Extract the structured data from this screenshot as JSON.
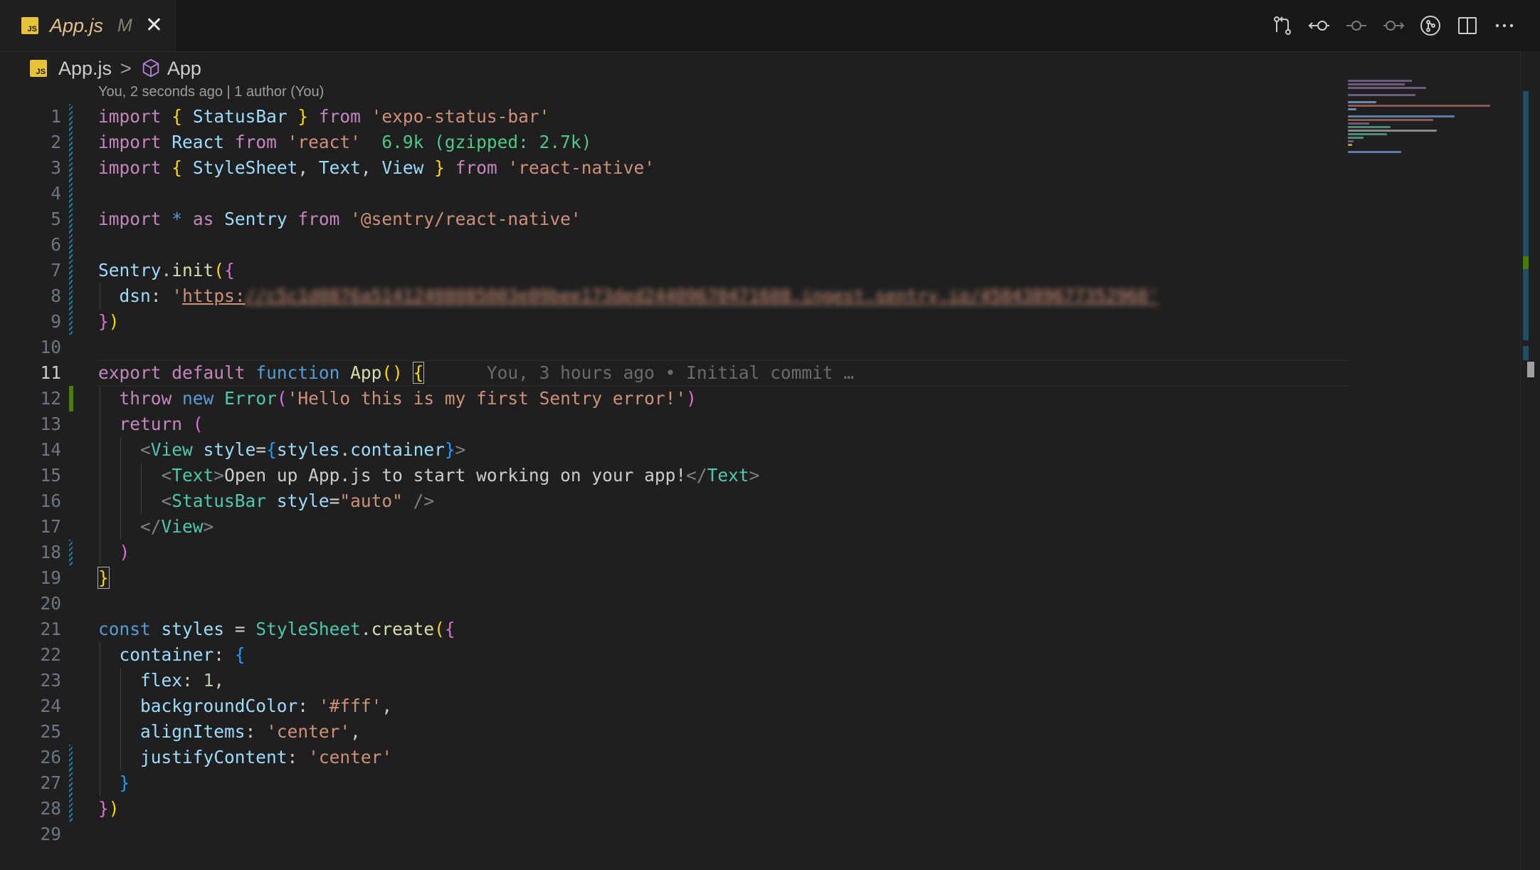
{
  "tab": {
    "icon_label": "JS",
    "title": "App.js",
    "status": "M",
    "close_glyph": "✕"
  },
  "toolbar": {
    "actions": [
      {
        "icon": "open-changes-icon"
      },
      {
        "icon": "previous-change-icon"
      },
      {
        "icon": "commit-icon"
      },
      {
        "icon": "next-change-icon"
      },
      {
        "icon": "git-lens-icon"
      },
      {
        "icon": "split-editor-icon"
      },
      {
        "icon": "more-actions-icon"
      }
    ]
  },
  "breadcrumb": {
    "file_icon_label": "JS",
    "file": "App.js",
    "separator": ">",
    "symbol_icon": "symbol-method-icon",
    "symbol": "App"
  },
  "blame_header": "You, 2 seconds ago | 1 author (You)",
  "editor": {
    "active_line": 11,
    "line_numbers": [
      "1",
      "2",
      "3",
      "4",
      "5",
      "6",
      "7",
      "8",
      "9",
      "10",
      "11",
      "12",
      "13",
      "14",
      "15",
      "16",
      "17",
      "18",
      "19",
      "20",
      "21",
      "22",
      "23",
      "24",
      "25",
      "26",
      "27",
      "28",
      "29"
    ],
    "tokens": {
      "import": "import",
      "from": "from",
      "lb": "{",
      "rb": "}",
      "statusbar": "StatusBar",
      "expo_status_bar": "'expo-status-bar'",
      "react": "React",
      "react_str": "'react'",
      "import_cost": "6.9k (gzipped: 2.7k)",
      "stylesheet": "StyleSheet",
      "text": "Text",
      "view": "View",
      "comma": ",",
      "react_native_str": "'react-native'",
      "star": "*",
      "as": "as",
      "sentry": "Sentry",
      "sentry_str": "'@sentry/react-native'",
      "init": "init",
      "dot": ".",
      "lp": "(",
      "rp": ")",
      "dsn": "dsn",
      "colon": ":",
      "quote": "'",
      "https": "https:",
      "dsn_rest": "//c5c1d0876a51412408085003e09bee173ded24409670471608.ingest.sentry.io/4504389677352960'",
      "export": "export",
      "default": "default",
      "function": "function",
      "app": "App",
      "parens": "()",
      "inline_blame": "You, 3 hours ago • Initial commit …",
      "throw": "throw",
      "new": "new",
      "error": "Error",
      "error_msg": "'Hello this is my first Sentry error!'",
      "return": "return",
      "lt": "<",
      "gt": ">",
      "close_lt": "</",
      "self_close": "/>",
      "style": "style",
      "eq": "=",
      "styles": "styles",
      "container": "container",
      "text_content": "Open up App.js to start working on your app!",
      "auto_str": "\"auto\"",
      "const": "const",
      "create": "create",
      "flex": "flex",
      "one": "1",
      "bg": "backgroundColor",
      "fff": "'#fff'",
      "align": "alignItems",
      "center": "'center'",
      "justify": "justifyContent"
    }
  },
  "colors": {
    "editor_bg": "#1f1f1f",
    "keyword": "#c586c0",
    "storage": "#569cd6",
    "string": "#ce9178",
    "type": "#4ec9b0",
    "modified_gutter": "#1b81a8",
    "added_gutter": "#487e02"
  }
}
